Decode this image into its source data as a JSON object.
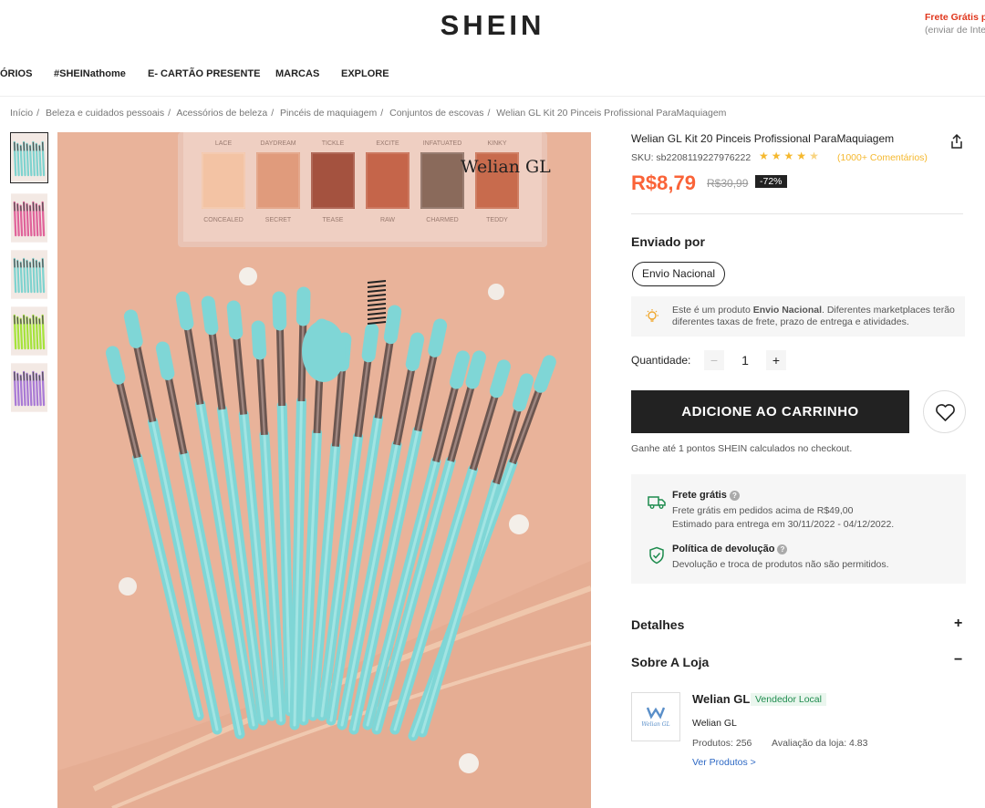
{
  "header": {
    "logo": "SHEIN",
    "promo_title": "Frete Grátis p",
    "promo_sub": "(enviar de Inte"
  },
  "nav": {
    "items": [
      "ÓRIOS",
      "#SHEINathome",
      "E- CARTÃO PRESENTE",
      "MARCAS",
      "EXPLORE"
    ]
  },
  "breadcrumb": [
    "Início",
    "Beleza e cuidados pessoais",
    "Acessórios de beleza",
    "Pincéis de maquiagem",
    "Conjuntos de escovas",
    "Welian GL Kit 20 Pinceis Profissional ParaMaquiagem"
  ],
  "gallery": {
    "thumb_colors": [
      "#7fd3cf",
      "#e0639a",
      "#7fd3cf",
      "#a6e33b",
      "#a97ad6"
    ],
    "brush_color": "#7fd6d6",
    "watermark": "Welian GL",
    "palette_top_labels": [
      "LACE",
      "DAYDREAM",
      "TICKLE",
      "EXCITE",
      "INFATUATED",
      "KINKY"
    ],
    "palette_bottom_labels": [
      "CONCEALED",
      "SECRET",
      "TEASE",
      "RAW",
      "CHARMED",
      "TEDDY"
    ]
  },
  "product": {
    "title": "Welian GL Kit 20 Pinceis Profissional ParaMaquiagem",
    "sku": "SKU: sb2208119227976222",
    "rating": 4.5,
    "reviews": "(1000+ Comentários)",
    "price": "R$8,79",
    "old_price": "R$30,99",
    "discount": "-72%",
    "accent_color": "#fa6338"
  },
  "shipping": {
    "label": "Enviado por",
    "option": "Envio Nacional",
    "notice_prefix": "Este é um produto ",
    "notice_bold": "Envio Nacional",
    "notice_suffix": ". Diferentes marketplaces terão diferentes taxas de frete, prazo de entrega e atividades."
  },
  "quantity": {
    "label": "Quantidade:",
    "value": "1",
    "minus": "−",
    "plus": "+"
  },
  "cart": {
    "button": "ADICIONE AO CARRINHO",
    "points": "Ganhe até 1 pontos SHEIN calculados no checkout."
  },
  "info": {
    "free_title": "Frete grátis",
    "free_line1": "Frete grátis em pedidos acima de R$49,00",
    "free_line2": "Estimado para entrega em 30/11/2022 - 04/12/2022.",
    "return_title": "Política de devolução",
    "return_line": "Devolução e troca de produtos não são permitidos."
  },
  "sections": {
    "details": "Detalhes",
    "details_sign": "+",
    "store": "Sobre A Loja",
    "store_sign": "−"
  },
  "store": {
    "name": "Welian GL",
    "badge": "Vendedor Local",
    "sub": "Welian GL",
    "products": "Produtos: 256",
    "rating": "Avaliação da loja: 4.83",
    "link": "Ver Produtos >",
    "logo_text": "Welian GL"
  }
}
